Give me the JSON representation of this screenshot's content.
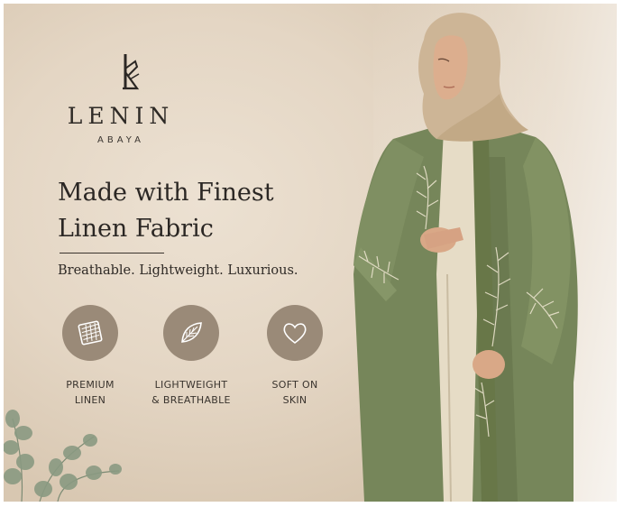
{
  "brand": {
    "name": "LENIN",
    "subtitle": "ABAYA",
    "logo_icon": "monogram-logo-icon"
  },
  "headline": {
    "line1": "Made with Finest",
    "line2": "Linen Fabric"
  },
  "tagline": "Breathable. Lightweight. Luxurious.",
  "features": [
    {
      "icon": "fabric-icon",
      "line1": "PREMIUM",
      "line2": "LINEN"
    },
    {
      "icon": "leaf-icon",
      "line1": "LIGHTWEIGHT",
      "line2": "& BREATHABLE"
    },
    {
      "icon": "heart-icon",
      "line1": "SOFT ON",
      "line2": "SKIN"
    }
  ],
  "colors": {
    "background": "#e4d6c4",
    "icon_circle": "#9a8a78",
    "abaya_green": "#7a8a5a",
    "hijab_beige": "#cdb596",
    "text_dark": "#2b2724"
  }
}
